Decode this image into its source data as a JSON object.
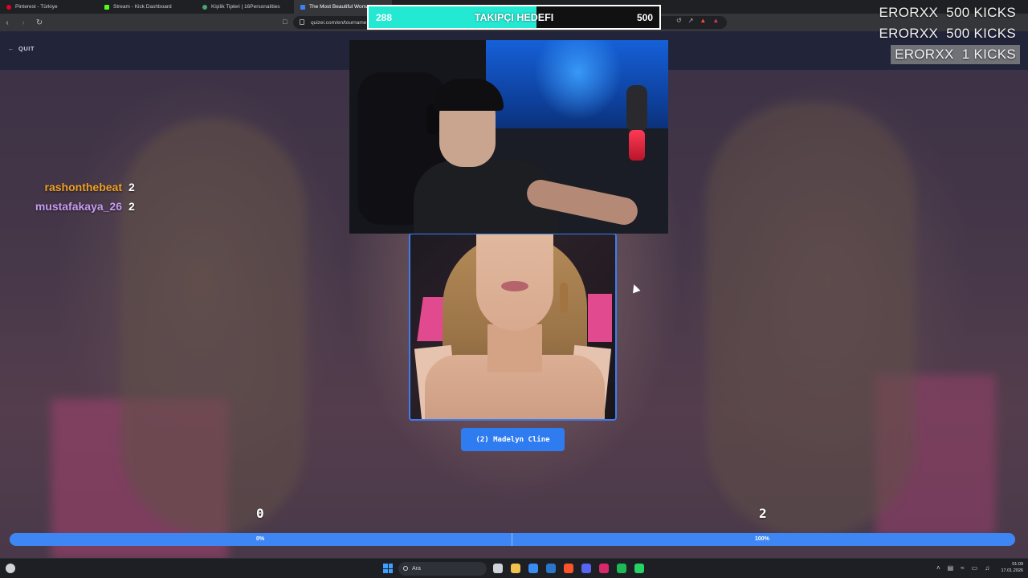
{
  "browser": {
    "tabs": [
      {
        "label": "Pinterest - Türkiye",
        "color": "#e60023",
        "active": false
      },
      {
        "label": "Stream - Kick Dashboard",
        "color": "#53fc18",
        "active": false
      },
      {
        "label": "Kişilik Tipleri | 16Personalities",
        "color": "#4aa37b",
        "active": false
      },
      {
        "label": "The Most Beautiful Woman",
        "color": "#3b82f6",
        "active": true
      }
    ],
    "url": "quizei.com/en/tourname"
  },
  "page": {
    "quit_label": "QUIT",
    "leaderboard": [
      {
        "name": "rashonthebeat",
        "score": "2",
        "color": "#f0a020"
      },
      {
        "name": "mustafakaya_26",
        "score": "2",
        "color": "#c69cf0"
      }
    ],
    "contestant": {
      "label": "(2) Madelyn Cline"
    },
    "score_left": "0",
    "score_right": "2",
    "progress": {
      "left_pct_label": "0%",
      "right_pct_label": "100%",
      "fill_fraction": 1.0
    }
  },
  "overlay": {
    "goal": {
      "current": "288",
      "label": "TAKIPÇI HEDEFI",
      "target": "500",
      "fraction": 0.576
    },
    "kicks": [
      "ERORXX  500 KICKS",
      "ERORXX  500 KICKS",
      "ERORXX  1 KICKS"
    ]
  },
  "taskbar": {
    "search_placeholder": "Ara",
    "time": "01:09",
    "date": "17.01.2026",
    "apps": [
      {
        "name": "task-view-icon",
        "color": "#cfd3da"
      },
      {
        "name": "file-explorer-icon",
        "color": "#f2c14e"
      },
      {
        "name": "mail-icon",
        "color": "#3a8df0"
      },
      {
        "name": "steam-icon",
        "color": "#2a77c9"
      },
      {
        "name": "brave-icon",
        "color": "#fb542b"
      },
      {
        "name": "discord-icon",
        "color": "#5865f2"
      },
      {
        "name": "instagram-icon",
        "color": "#d6286b"
      },
      {
        "name": "spotify-icon",
        "color": "#1db954"
      },
      {
        "name": "whatsapp-icon",
        "color": "#25d366"
      }
    ]
  }
}
